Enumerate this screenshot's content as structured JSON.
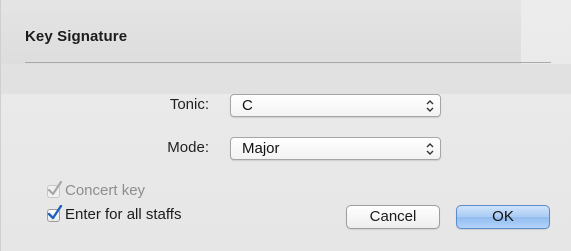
{
  "dialog": {
    "title": "Key Signature",
    "tonic_label": "Tonic:",
    "tonic_value": "C",
    "mode_label": "Mode:",
    "mode_value": "Major",
    "concert_key_label": "Concert key",
    "concert_key_checked": true,
    "concert_key_enabled": false,
    "all_staffs_label": "Enter for all staffs",
    "all_staffs_checked": true,
    "cancel_label": "Cancel",
    "ok_label": "OK"
  },
  "icons": {
    "popup_arrows": "chevron-updown-icon",
    "check": "checkmark-icon"
  },
  "colors": {
    "default_button": "#a9cbf3",
    "checkmark_active": "#1f5fbf",
    "checkmark_disabled": "#a7a7a7"
  }
}
